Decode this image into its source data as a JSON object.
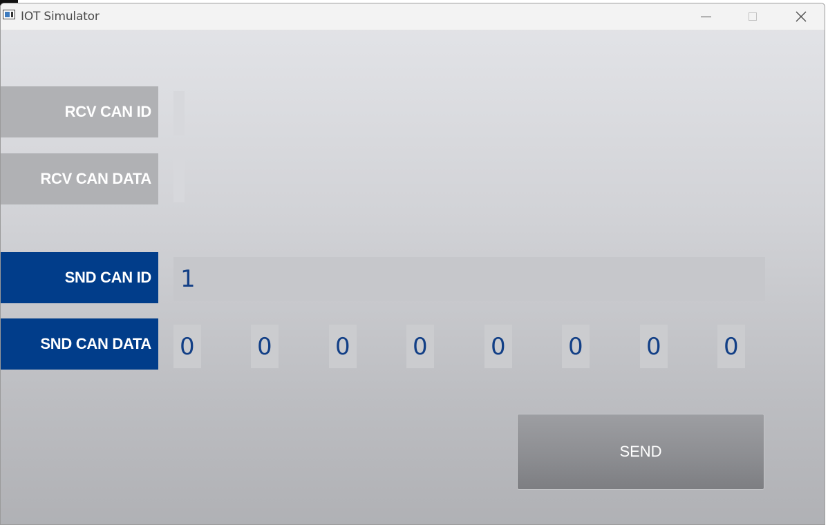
{
  "window": {
    "title": "IOT Simulator"
  },
  "labels": {
    "rcv_can_id": "RCV CAN ID",
    "rcv_can_data": "RCV CAN DATA",
    "snd_can_id": "SND CAN ID",
    "snd_can_data": "SND CAN DATA"
  },
  "fields": {
    "rcv_can_id": "",
    "rcv_can_data": "",
    "snd_can_id": "1",
    "snd_can_data": [
      "0",
      "0",
      "0",
      "0",
      "0",
      "0",
      "0",
      "0"
    ]
  },
  "buttons": {
    "send": "SEND"
  },
  "colors": {
    "label_active": "#013d8a",
    "label_inactive": "#b0b1b4",
    "value_text": "#123f86"
  }
}
